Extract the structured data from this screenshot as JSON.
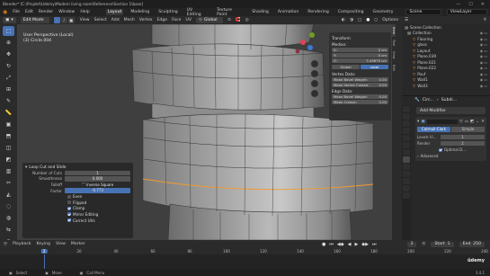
{
  "window": {
    "title": "Blender* [C:\\Projekt\\Udemy\\Modern living room\\Reference\\Section 1\\base]",
    "controls": [
      "—",
      "☐",
      "✕"
    ]
  },
  "menubar": {
    "menus": [
      "File",
      "Edit",
      "Render",
      "Window",
      "Help"
    ],
    "workspaces": [
      "Layout",
      "Modeling",
      "Sculpting",
      "UV Editing",
      "Texture Paint",
      "Shading",
      "Animation",
      "Rendering",
      "Compositing",
      "Geometry"
    ],
    "active_workspace": "Layout",
    "scene": "Scene",
    "view_layer": "ViewLayer"
  },
  "header3d": {
    "mode": "Edit Mode",
    "menus": [
      "View",
      "Select",
      "Add",
      "Mesh",
      "Vertex",
      "Edge",
      "Face",
      "UV"
    ],
    "transform": "Global",
    "options_label": "Options"
  },
  "viewport": {
    "view_name": "User Perspective (Local)",
    "object_line": "(3) Circle.004"
  },
  "npanel": {
    "tabs": [
      "Item",
      "Tool",
      "View",
      "Edit"
    ],
    "active_tab": "Item",
    "transform_label": "Transform",
    "median_label": "Median:",
    "x_label": "X:",
    "x": "0 cm",
    "y_label": "Y:",
    "y": "0 cm",
    "z_label": "Z:",
    "z": "3.49879 cm",
    "global_label": "Global",
    "local_label": "Local",
    "vertex_data_label": "Vertex Data:",
    "mean_bevel_weight_label": "Mean Bevel Weight:",
    "mean_bevel_weight": "0.00",
    "mean_vertex_crease_label": "Mean Vertex Crease:",
    "mean_vertex_crease": "0.00",
    "edge_data_label": "Edge Data:",
    "edge_bevel_label": "Mean Bevel Weight:",
    "edge_bevel": "0.00",
    "mean_crease_label": "Mean Crease:",
    "mean_crease": "0.00"
  },
  "last_op": {
    "title": "Loop Cut and Slide",
    "number_of_cuts_label": "Number of Cuts",
    "number_of_cuts": "1",
    "smoothness_label": "Smoothness",
    "smoothness": "0.000",
    "falloff_label": "Falloff",
    "falloff": "Inverse Square",
    "factor_label": "Factor",
    "factor": "-0.773",
    "even_label": "Even",
    "even": false,
    "flipped_label": "Flipped",
    "flipped": false,
    "clamp_label": "Clamp",
    "clamp": true,
    "mirror_editing_label": "Mirror Editing",
    "mirror_editing": true,
    "correct_uvs_label": "Correct UVs",
    "correct_uvs": true
  },
  "outliner": {
    "title": "Scene Collection",
    "rows": [
      {
        "label": "Collection",
        "indent": 0,
        "selected": false
      },
      {
        "label": "Flooring",
        "indent": 1,
        "selected": false
      },
      {
        "label": "glass",
        "indent": 1,
        "selected": false
      },
      {
        "label": "Layout",
        "indent": 1,
        "selected": false
      },
      {
        "label": "Plane.039",
        "indent": 1,
        "selected": false
      },
      {
        "label": "Plane.021",
        "indent": 1,
        "selected": false
      },
      {
        "label": "Plane.022",
        "indent": 1,
        "selected": false
      },
      {
        "label": "Pouf",
        "indent": 1,
        "selected": false
      },
      {
        "label": "Wall1",
        "indent": 1,
        "selected": false
      },
      {
        "label": "Wall3",
        "indent": 1,
        "selected": false
      }
    ]
  },
  "properties": {
    "object_name": "Circ...",
    "modifier_name": "Subdi...",
    "add_modifier_label": "Add Modifier",
    "btn_catmull": "Catmull-Clark",
    "btn_simple": "Simple",
    "levels_viewport_label": "Levels Vi...",
    "levels_viewport": "1",
    "render_label": "Render",
    "render_value": "2",
    "optimal_display_label": "Optimal D...",
    "advanced_label": "Advanced"
  },
  "timeline": {
    "menus": [
      "Playback",
      "Keying",
      "View",
      "Marker"
    ],
    "current_frame": "3",
    "start_label": "Start",
    "start": "1",
    "end_label": "End",
    "end": "250",
    "frame_field": "3",
    "ticks": [
      "20",
      "40",
      "60",
      "80",
      "100",
      "120",
      "140",
      "160",
      "180",
      "200",
      "220",
      "240"
    ]
  },
  "status": {
    "items": [
      "Select",
      "Move",
      "Call Menu"
    ],
    "version": "3.4.1"
  },
  "watermark": "ûdemy",
  "colors": {
    "accent": "#4772b3",
    "bg_dark": "#1d1d1d",
    "viewport": "#3f3f3f"
  }
}
